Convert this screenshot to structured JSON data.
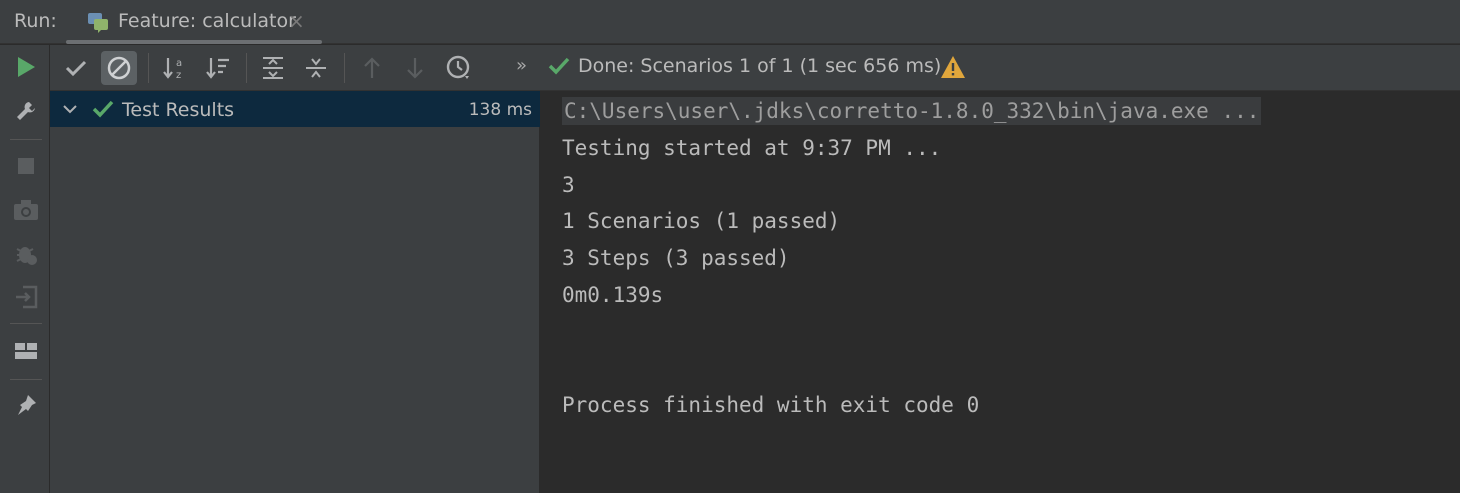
{
  "run_label": "Run:",
  "tab": {
    "title": "Feature: calculator",
    "close": "×"
  },
  "toolbar": {
    "more": "»",
    "status_text": "Done: Scenarios 1 of 1  (1 sec 656 ms)"
  },
  "tree": {
    "root_label": "Test Results",
    "root_time": "138 ms"
  },
  "console": {
    "command": "C:\\Users\\user\\.jdks\\corretto-1.8.0_332\\bin\\java.exe ...",
    "lines": [
      "Testing started at 9:37 PM ...",
      "3",
      "1 Scenarios (1 passed)",
      "3 Steps (3 passed)",
      "0m0.139s",
      "Process finished with exit code 0"
    ]
  },
  "colors": {
    "accent_green": "#59a869",
    "warning_yellow": "#e0a63c",
    "selection_bg": "#0d293e"
  },
  "icons": {
    "vertical_toolbar": [
      "run-icon",
      "wrench-icon",
      "stop-icon",
      "camera-icon",
      "debug-icon",
      "import-icon",
      "layout-icon",
      "pin-icon"
    ],
    "horizontal_toolbar": [
      "show-passed-icon",
      "show-ignored-icon",
      "sort-alpha-icon",
      "sort-duration-icon",
      "expand-all-icon",
      "collapse-all-icon",
      "prev-failed-icon",
      "next-failed-icon",
      "history-icon"
    ]
  }
}
